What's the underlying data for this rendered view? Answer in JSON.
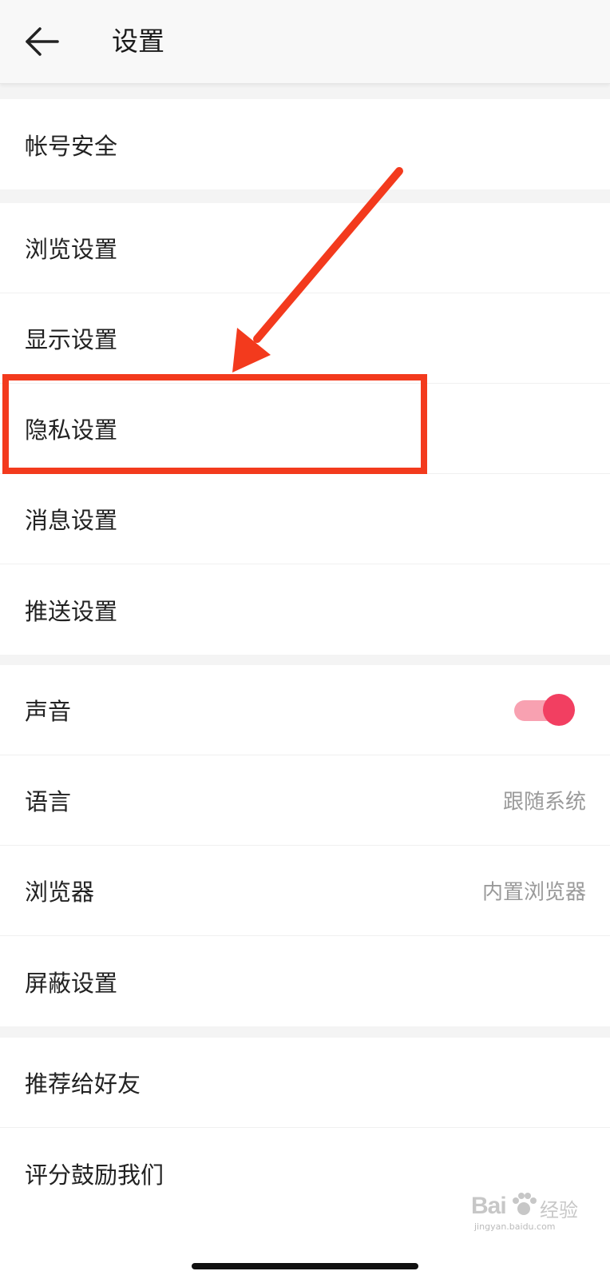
{
  "header": {
    "title": "设置"
  },
  "groups": [
    {
      "rows": [
        {
          "label": "帐号安全"
        }
      ]
    },
    {
      "rows": [
        {
          "label": "浏览设置"
        },
        {
          "label": "显示设置"
        },
        {
          "label": "隐私设置"
        },
        {
          "label": "消息设置"
        },
        {
          "label": "推送设置"
        }
      ]
    },
    {
      "rows": [
        {
          "label": "声音",
          "toggle_on": true
        },
        {
          "label": "语言",
          "value": "跟随系统"
        },
        {
          "label": "浏览器",
          "value": "内置浏览器"
        },
        {
          "label": "屏蔽设置"
        }
      ]
    },
    {
      "rows": [
        {
          "label": "推荐给好友"
        },
        {
          "label": "评分鼓励我们"
        }
      ]
    }
  ],
  "annotation": {
    "color": "#f33a1d",
    "highlighted_item": "隐私设置"
  },
  "colors": {
    "toggle_on": "#f23f61",
    "toggle_track": "#f8a1b1"
  },
  "watermark": {
    "brand": "Bai",
    "brand_cn": "经验",
    "url": "jingyan.baidu.com"
  }
}
